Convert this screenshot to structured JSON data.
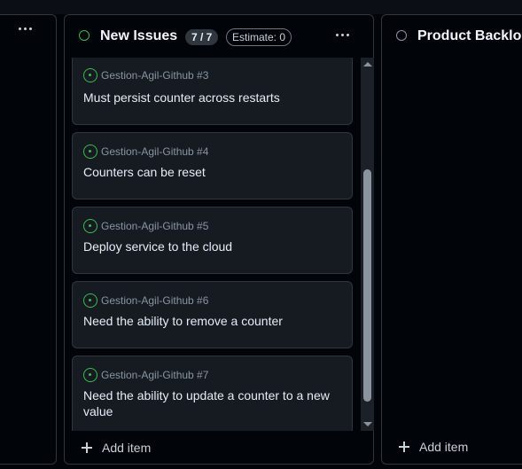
{
  "colors": {
    "background": "#010409",
    "column_border": "#30363d",
    "card_bg": "#161b22",
    "open_issue_green": "#3fb950",
    "muted_text": "#8b949e"
  },
  "left_column": {
    "menu_icon": "kebab-horizontal-icon"
  },
  "new_issues_column": {
    "status_icon": "circle-green-icon",
    "title": "New Issues",
    "count": "7 / 7",
    "estimate": "Estimate: 0",
    "menu_icon": "kebab-horizontal-icon",
    "cards": [
      {
        "icon": "issue-opened-icon",
        "repo": "Gestion-Agil-Github #3",
        "title": "Must persist counter across restarts"
      },
      {
        "icon": "issue-opened-icon",
        "repo": "Gestion-Agil-Github #4",
        "title": "Counters can be reset"
      },
      {
        "icon": "issue-opened-icon",
        "repo": "Gestion-Agil-Github #5",
        "title": "Deploy service to the cloud"
      },
      {
        "icon": "issue-opened-icon",
        "repo": "Gestion-Agil-Github #6",
        "title": "Need the ability to remove a counter"
      },
      {
        "icon": "issue-opened-icon",
        "repo": "Gestion-Agil-Github #7",
        "title": "Need the ability to update a counter to a new value"
      }
    ],
    "add_item": "Add item"
  },
  "product_backlog_column": {
    "status_icon": "circle-gray-icon",
    "title": "Product Backlo",
    "add_item": "Add item"
  }
}
